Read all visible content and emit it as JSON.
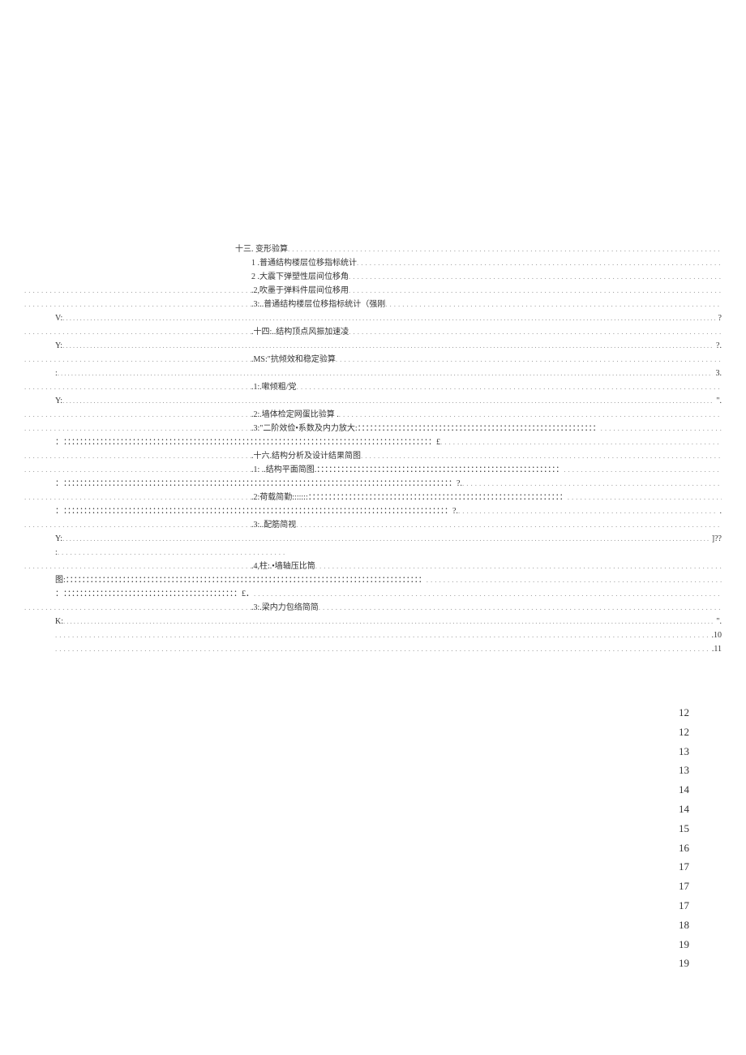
{
  "toc": [
    {
      "indent": "indent-0",
      "prefix": "",
      "label": "十三. 变形验算",
      "page": "",
      "prefixWidth": 0
    },
    {
      "indent": "indent-1",
      "prefix": "",
      "label": "1  .普通结构楼层位移指标统计",
      "page": "",
      "prefixWidth": 0
    },
    {
      "indent": "indent-1",
      "prefix": "",
      "label": "2  .大震下弹塑性层间位移角 ",
      "page": "",
      "prefixWidth": 0
    },
    {
      "indent": "indent-2",
      "prefix": "",
      "label": ".2,吹墨于弹料件层间位移用 ",
      "page": "",
      "prefixWidth": 280
    },
    {
      "indent": "indent-2",
      "prefix": "",
      "label": ".3:..普通结构楼层位移指标统计（强刚",
      "page": "",
      "prefixWidth": 280
    },
    {
      "indent": "indent-2",
      "prefix": "V:",
      "label": "",
      "page": "?",
      "prefixWidth": 0,
      "colons": true
    },
    {
      "indent": "indent-2",
      "prefix": "",
      "label": ".十四:..结构顶点风振加速凌",
      "page": "",
      "prefixWidth": 280
    },
    {
      "indent": "indent-2",
      "prefix": "Y:",
      "label": "",
      "page": "?.",
      "prefixWidth": 0,
      "colons": true
    },
    {
      "indent": "indent-2",
      "prefix": "",
      "label": ".MS:\"抗倾效和稳定验算",
      "page": "",
      "prefixWidth": 280
    },
    {
      "indent": "indent-2",
      "prefix": ":",
      "label": "",
      "page": "3.",
      "prefixWidth": 0,
      "colons": true
    },
    {
      "indent": "indent-2",
      "prefix": "",
      "label": ".1:.嗽倾粗/党",
      "page": "",
      "prefixWidth": 280
    },
    {
      "indent": "indent-2",
      "prefix": "Y:",
      "label": "",
      "page": "\".",
      "prefixWidth": 0,
      "colons": true
    },
    {
      "indent": "indent-2",
      "prefix": "",
      "label": ".2:.墙体检定网蛋比验算 .",
      "page": "",
      "prefixWidth": 280
    },
    {
      "indent": "indent-2",
      "prefix": "",
      "label": ".3:\"二阶效俭•系数及内力放大:：：：：：：：：：：：：：：：：：：：：：：：：：：：：：：：：：：：：：：：：：：：：：：：：：：：：：：：：：：：",
      "page": "",
      "prefixWidth": 280
    },
    {
      "indent": "indent-2",
      "prefix": "：",
      "label": "：：：：：：：：：：：：：：：：：：：：：：：：：：：：：：：：：：：：：：：：：：：：：：：：：：：：：：：：：：：：：：：：：：：：：：：：：：：：：：：：：：：：：：：：：：：£",
      "page": "",
      "prefixWidth": 0
    },
    {
      "indent": "indent-2",
      "prefix": "",
      "label": ".十六.结构分析及设计结果简图 ",
      "page": "",
      "prefixWidth": 280
    },
    {
      "indent": "indent-2",
      "prefix": "",
      "label": ".1: ..结构平面简图.：：：：：：：：：：：：：：：：：：：：：：：：：：：：：：：：：：：：：：：：：：：：：：：：：：：：：：：：：：：：",
      "page": "",
      "prefixWidth": 280
    },
    {
      "indent": "indent-2",
      "prefix": "：",
      "label": "：：：：：：：：：：：：：：：：：：：：：：：：：：：：：：：：：：：：：：：：：：：：：：：：：：：：：：：：：：：：：：：：：：：：：：：：：：：：：：：：：：：：：：：：：：：：：：：：?.",
      "page": "",
      "prefixWidth": 0
    },
    {
      "indent": "indent-2",
      "prefix": "",
      "label": ".2:荷载简勤:::::::：：：：：：：：：：：：：：：：：：：：：：：：：：：：：：：：：：：：：：：：：：：：：：：：：：：：：：：：：：：：：：：",
      "page": "",
      "prefixWidth": 280
    },
    {
      "indent": "indent-2",
      "prefix": "：",
      "label": "：：：：：：：：：：：：：：：：：：：：：：：：：：：：：：：：：：：：：：：：：：：：：：：：：：：：：：：：：：：：：：：：：：：：：：：：：：：：：：：：：：：：：：：：：：：：：：：?.",
      "page": ".",
      "prefixWidth": 0
    },
    {
      "indent": "indent-2",
      "prefix": "",
      "label": ".3:..配筋简视",
      "page": "",
      "prefixWidth": 280
    },
    {
      "indent": "indent-2",
      "prefix": "Y:",
      "label": "",
      "page": "]??",
      "prefixWidth": 0,
      "colons": true
    },
    {
      "indent": "indent-2",
      "prefix": ":",
      "label": "",
      "page": "",
      "prefixWidth": 0,
      "narrow": true
    },
    {
      "indent": "indent-2",
      "prefix": "",
      "label": ".4,柱:.•墙轴压比筒",
      "page": "",
      "prefixWidth": 280
    },
    {
      "indent": "indent-2",
      "prefix": "图:",
      "label": "：：：：：：：：：：：：：：：：：：：：：：：：：：：：：：：：：：：：：：：：：：：：：：：：：：：：：：：：：：：：：：：：：：：：：：：：：：：：：：：：：：：：：：：：",
      "page": "",
      "prefixWidth": 0
    },
    {
      "indent": "indent-2",
      "prefix": "：",
      "label": "：：：：：：：：：：：：：：：：：：：：：：：：：：：：：：：：：：：：：：：：：：：£．",
      "page": "",
      "prefixWidth": 0
    },
    {
      "indent": "indent-2",
      "prefix": "",
      "label": ".3:.梁内力包络简简",
      "page": "",
      "prefixWidth": 280
    },
    {
      "indent": "indent-2",
      "prefix": "K:",
      "label": "",
      "page": "\".",
      "prefixWidth": 0,
      "colons": true
    },
    {
      "indent": "indent-2",
      "prefix": "",
      "label": "",
      "page": ".10",
      "prefixWidth": 0,
      "fulldots": true
    },
    {
      "indent": "indent-2",
      "prefix": "",
      "label": "",
      "page": ".11",
      "prefixWidth": 0,
      "fulldots": true
    }
  ],
  "pageNumbers": [
    "12",
    "12",
    "13",
    "13",
    "14",
    "14",
    "15",
    "16",
    "17",
    "17",
    "17",
    "18",
    "19",
    "19"
  ]
}
